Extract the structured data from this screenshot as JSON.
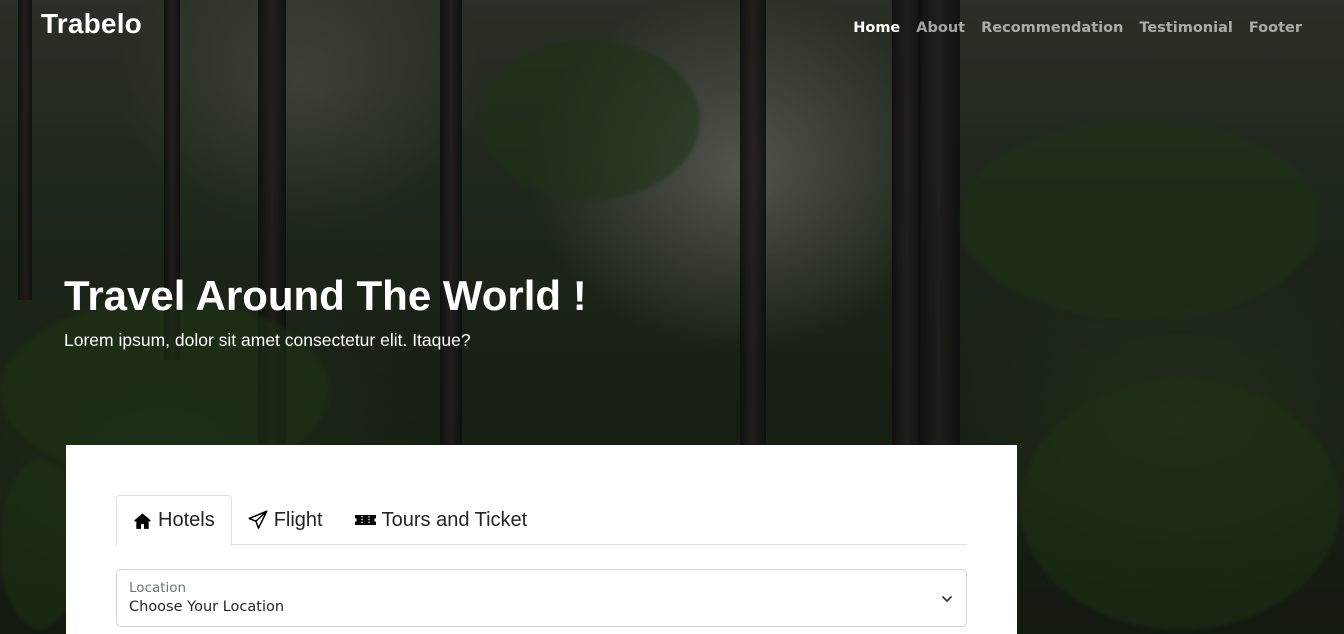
{
  "brand": "Trabelo",
  "nav": [
    {
      "label": "Home",
      "active": true
    },
    {
      "label": "About"
    },
    {
      "label": "Recommendation"
    },
    {
      "label": "Testimonial"
    },
    {
      "label": "Footer"
    }
  ],
  "hero": {
    "title": "Travel Around The World !",
    "subtitle": "Lorem ipsum, dolor sit amet consectetur elit. Itaque?"
  },
  "search": {
    "tabs": [
      {
        "label": "Hotels",
        "icon": "house-icon",
        "active": true
      },
      {
        "label": "Flight",
        "icon": "paper-plane-icon"
      },
      {
        "label": "Tours and Ticket",
        "icon": "ticket-icon"
      }
    ],
    "location": {
      "label": "Location",
      "value": "Choose Your Location"
    }
  }
}
